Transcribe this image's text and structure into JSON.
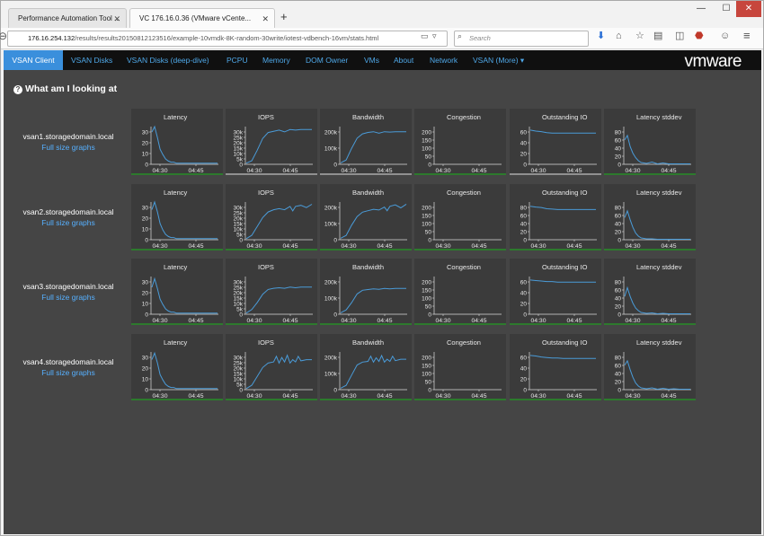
{
  "browser": {
    "tabs": [
      {
        "title": "Performance Automation Tool ..."
      },
      {
        "title": "VC 176.16.0.36 (VMware vCente..."
      }
    ],
    "new_tab_label": "+",
    "url_host": "176.16.254.132",
    "url_path": "/results/results20150812123516/example-10vmdk-8K-random-30write/iotest-vdbench-16vm/stats.html",
    "search_placeholder": "Search",
    "window_controls": {
      "minimize": "—",
      "maximize": "☐",
      "close": "✕"
    }
  },
  "nav": {
    "items": [
      "VSAN Client",
      "VSAN Disks",
      "VSAN Disks (deep-dive)",
      "PCPU",
      "Memory",
      "DOM Owner",
      "VMs",
      "About",
      "Network",
      "VSAN (More) ▾"
    ],
    "active_index": 0,
    "logo_prefix": "vm",
    "logo_suffix": "ware"
  },
  "heading": "What am I looking at",
  "hosts": [
    {
      "name": "vsan1.storagedomain.local",
      "link": "Full size graphs"
    },
    {
      "name": "vsan2.storagedomain.local",
      "link": "Full size graphs"
    },
    {
      "name": "vsan3.storagedomain.local",
      "link": "Full size graphs"
    },
    {
      "name": "vsan4.storagedomain.local",
      "link": "Full size graphs"
    }
  ],
  "chart_titles": [
    "Latency",
    "IOPS",
    "Bandwidth",
    "Congestion",
    "Outstanding IO",
    "Latency stddev"
  ],
  "x_ticks": [
    "04:30",
    "04:45"
  ],
  "chart_data": [
    {
      "host": "vsan1.storagedomain.local",
      "type": "line",
      "charts": [
        {
          "title": "Latency",
          "yticks": [
            "0",
            "10",
            "20",
            "30"
          ],
          "ymax": 35,
          "shape": "decay",
          "x": [
            0,
            1,
            2,
            3,
            4,
            5,
            6,
            7,
            8,
            9,
            10,
            12,
            14,
            16,
            18,
            20,
            24
          ],
          "y": [
            30,
            35,
            25,
            14,
            9,
            5,
            3,
            2,
            2,
            1,
            1,
            1,
            1,
            1,
            1,
            1,
            1
          ]
        },
        {
          "title": "IOPS",
          "yticks": [
            "0",
            "5k",
            "10k",
            "15k",
            "20k",
            "25k",
            "30k"
          ],
          "ymax": 32000,
          "x": [
            0,
            2,
            4,
            6,
            8,
            10,
            12,
            14,
            16,
            18,
            20,
            24
          ],
          "y": [
            1000,
            3000,
            12000,
            22000,
            27000,
            28000,
            29000,
            27500,
            29500,
            29000,
            29500,
            29500
          ]
        },
        {
          "title": "Bandwidth",
          "yticks": [
            "0",
            "100k",
            "200k"
          ],
          "ymax": 260000,
          "x": [
            0,
            2,
            4,
            6,
            8,
            10,
            12,
            14,
            16,
            18,
            20,
            24
          ],
          "y": [
            10000,
            30000,
            110000,
            180000,
            210000,
            220000,
            225000,
            215000,
            225000,
            222000,
            225000,
            225000
          ]
        },
        {
          "title": "Congestion",
          "yticks": [
            "0",
            "50",
            "100",
            "150",
            "200"
          ],
          "ymax": 210,
          "x": [],
          "y": []
        },
        {
          "title": "Outstanding IO",
          "yticks": [
            "0",
            "20",
            "40",
            "60"
          ],
          "ymax": 75,
          "x": [
            0,
            2,
            4,
            6,
            8,
            10,
            12,
            14,
            16,
            18,
            20,
            24
          ],
          "y": [
            68,
            66,
            65,
            63,
            62,
            62,
            62,
            62,
            62,
            62,
            62,
            62
          ]
        },
        {
          "title": "Latency stddev",
          "yticks": [
            "0",
            "20",
            "40",
            "60",
            "80"
          ],
          "ymax": 85,
          "x": [
            0,
            1,
            2,
            3,
            4,
            5,
            6,
            8,
            10,
            12,
            14,
            16,
            20,
            24
          ],
          "y": [
            55,
            65,
            40,
            25,
            15,
            8,
            4,
            2,
            5,
            1,
            3,
            1,
            1,
            1
          ]
        }
      ]
    },
    {
      "host": "vsan2.storagedomain.local",
      "type": "line",
      "charts": [
        {
          "title": "Latency",
          "yticks": [
            "0",
            "10",
            "20",
            "30"
          ],
          "ymax": 35,
          "x": [
            0,
            1,
            2,
            3,
            4,
            5,
            6,
            7,
            8,
            9,
            10,
            12,
            14,
            16,
            18,
            20,
            24
          ],
          "y": [
            28,
            35,
            26,
            15,
            9,
            5,
            3,
            2,
            2,
            1,
            1,
            1,
            1,
            1,
            1,
            1,
            1
          ]
        },
        {
          "title": "IOPS",
          "yticks": [
            "0",
            "5k",
            "10k",
            "15k",
            "20k",
            "25k",
            "30k"
          ],
          "ymax": 34000,
          "x": [
            0,
            2,
            4,
            6,
            8,
            10,
            12,
            14,
            16,
            17,
            18,
            20,
            22,
            24
          ],
          "y": [
            1000,
            4000,
            12000,
            20000,
            25000,
            27000,
            28000,
            27000,
            30000,
            26000,
            30000,
            31000,
            29000,
            32000
          ]
        },
        {
          "title": "Bandwidth",
          "yticks": [
            "0",
            "100k",
            "200k"
          ],
          "ymax": 260000,
          "x": [
            0,
            2,
            4,
            6,
            8,
            10,
            12,
            14,
            16,
            17,
            18,
            20,
            22,
            24
          ],
          "y": [
            10000,
            30000,
            100000,
            160000,
            190000,
            200000,
            210000,
            205000,
            225000,
            200000,
            230000,
            240000,
            220000,
            245000
          ]
        },
        {
          "title": "Congestion",
          "yticks": [
            "0",
            "50",
            "100",
            "150",
            "200"
          ],
          "ymax": 210,
          "x": [],
          "y": []
        },
        {
          "title": "Outstanding IO",
          "yticks": [
            "0",
            "20",
            "40",
            "60",
            "80"
          ],
          "ymax": 90,
          "x": [
            0,
            2,
            4,
            6,
            8,
            10,
            12,
            14,
            16,
            18,
            20,
            24
          ],
          "y": [
            80,
            78,
            77,
            74,
            73,
            72,
            72,
            72,
            72,
            72,
            72,
            72
          ]
        },
        {
          "title": "Latency stddev",
          "yticks": [
            "0",
            "20",
            "40",
            "60",
            "80"
          ],
          "ymax": 85,
          "x": [
            0,
            1,
            2,
            3,
            4,
            5,
            6,
            8,
            10,
            12,
            14,
            16,
            20,
            24
          ],
          "y": [
            50,
            65,
            45,
            28,
            15,
            8,
            4,
            2,
            2,
            1,
            1,
            1,
            1,
            1
          ]
        }
      ]
    },
    {
      "host": "vsan3.storagedomain.local",
      "type": "line",
      "charts": [
        {
          "title": "Latency",
          "yticks": [
            "0",
            "10",
            "20",
            "30"
          ],
          "ymax": 35,
          "x": [
            0,
            1,
            2,
            3,
            4,
            5,
            6,
            7,
            8,
            9,
            10,
            12,
            14,
            16,
            18,
            20,
            24
          ],
          "y": [
            25,
            33,
            24,
            14,
            9,
            5,
            3,
            2,
            2,
            1,
            1,
            1,
            1,
            1,
            1,
            1,
            1
          ]
        },
        {
          "title": "IOPS",
          "yticks": [
            "0",
            "5k",
            "10k",
            "15k",
            "20k",
            "25k",
            "30k"
          ],
          "ymax": 32000,
          "x": [
            0,
            2,
            4,
            6,
            8,
            10,
            12,
            14,
            16,
            18,
            20,
            24
          ],
          "y": [
            1000,
            4000,
            10000,
            17000,
            21000,
            22000,
            22500,
            22000,
            23000,
            22500,
            23000,
            23000
          ]
        },
        {
          "title": "Bandwidth",
          "yticks": [
            "0",
            "100k",
            "200k"
          ],
          "ymax": 260000,
          "x": [
            0,
            2,
            4,
            6,
            8,
            10,
            12,
            14,
            16,
            18,
            20,
            24
          ],
          "y": [
            10000,
            30000,
            80000,
            140000,
            165000,
            170000,
            175000,
            172000,
            178000,
            175000,
            178000,
            178000
          ]
        },
        {
          "title": "Congestion",
          "yticks": [
            "0",
            "50",
            "100",
            "150",
            "200"
          ],
          "ymax": 210,
          "x": [],
          "y": []
        },
        {
          "title": "Outstanding IO",
          "yticks": [
            "0",
            "20",
            "40",
            "60"
          ],
          "ymax": 75,
          "x": [
            0,
            2,
            4,
            6,
            8,
            10,
            12,
            14,
            16,
            18,
            20,
            24
          ],
          "y": [
            68,
            67,
            66,
            65,
            65,
            64,
            64,
            64,
            64,
            64,
            64,
            64
          ]
        },
        {
          "title": "Latency stddev",
          "yticks": [
            "0",
            "20",
            "40",
            "60",
            "80"
          ],
          "ymax": 85,
          "x": [
            0,
            1,
            2,
            3,
            4,
            5,
            6,
            8,
            10,
            12,
            14,
            16,
            20,
            24
          ],
          "y": [
            40,
            60,
            40,
            25,
            14,
            8,
            4,
            2,
            3,
            1,
            2,
            1,
            1,
            1
          ]
        }
      ]
    },
    {
      "host": "vsan4.storagedomain.local",
      "type": "line",
      "charts": [
        {
          "title": "Latency",
          "yticks": [
            "0",
            "10",
            "20",
            "30"
          ],
          "ymax": 35,
          "x": [
            0,
            1,
            2,
            3,
            4,
            5,
            6,
            7,
            8,
            9,
            10,
            12,
            14,
            16,
            18,
            20,
            24
          ],
          "y": [
            28,
            34,
            25,
            14,
            9,
            5,
            3,
            2,
            2,
            1,
            1,
            1,
            1,
            1,
            1,
            1,
            1
          ]
        },
        {
          "title": "IOPS",
          "yticks": [
            "0",
            "5k",
            "10k",
            "15k",
            "20k",
            "25k",
            "30k"
          ],
          "ymax": 34000,
          "x": [
            0,
            2,
            4,
            6,
            8,
            10,
            11,
            12,
            13,
            14,
            15,
            16,
            17,
            18,
            19,
            20,
            22,
            24
          ],
          "y": [
            1000,
            4000,
            12000,
            20000,
            24000,
            25000,
            30000,
            24000,
            29000,
            25000,
            31000,
            24000,
            27000,
            25000,
            30000,
            26000,
            27000,
            27000
          ]
        },
        {
          "title": "Bandwidth",
          "yticks": [
            "0",
            "100k",
            "200k"
          ],
          "ymax": 260000,
          "x": [
            0,
            2,
            4,
            6,
            8,
            10,
            11,
            12,
            13,
            14,
            15,
            16,
            17,
            18,
            19,
            20,
            22,
            24
          ],
          "y": [
            10000,
            30000,
            100000,
            170000,
            190000,
            195000,
            230000,
            190000,
            220000,
            195000,
            235000,
            190000,
            210000,
            195000,
            230000,
            200000,
            210000,
            210000
          ]
        },
        {
          "title": "Congestion",
          "yticks": [
            "0",
            "50",
            "100",
            "150",
            "200"
          ],
          "ymax": 210,
          "x": [],
          "y": []
        },
        {
          "title": "Outstanding IO",
          "yticks": [
            "0",
            "20",
            "40",
            "60"
          ],
          "ymax": 75,
          "x": [
            0,
            2,
            4,
            6,
            8,
            10,
            12,
            14,
            16,
            18,
            20,
            24
          ],
          "y": [
            68,
            67,
            65,
            64,
            63,
            63,
            62,
            62,
            62,
            62,
            62,
            62
          ]
        },
        {
          "title": "Latency stddev",
          "yticks": [
            "0",
            "20",
            "40",
            "60",
            "80"
          ],
          "ymax": 85,
          "x": [
            0,
            1,
            2,
            3,
            4,
            5,
            6,
            8,
            10,
            12,
            14,
            16,
            18,
            20,
            24
          ],
          "y": [
            55,
            65,
            45,
            28,
            15,
            8,
            4,
            2,
            4,
            1,
            3,
            1,
            2,
            1,
            1
          ]
        }
      ]
    }
  ],
  "colors": {
    "line": "#4a9bd8",
    "accent": "#3a8fdc",
    "link": "#56b0ff",
    "good": "#2d7a2d",
    "neutral": "#909090"
  }
}
